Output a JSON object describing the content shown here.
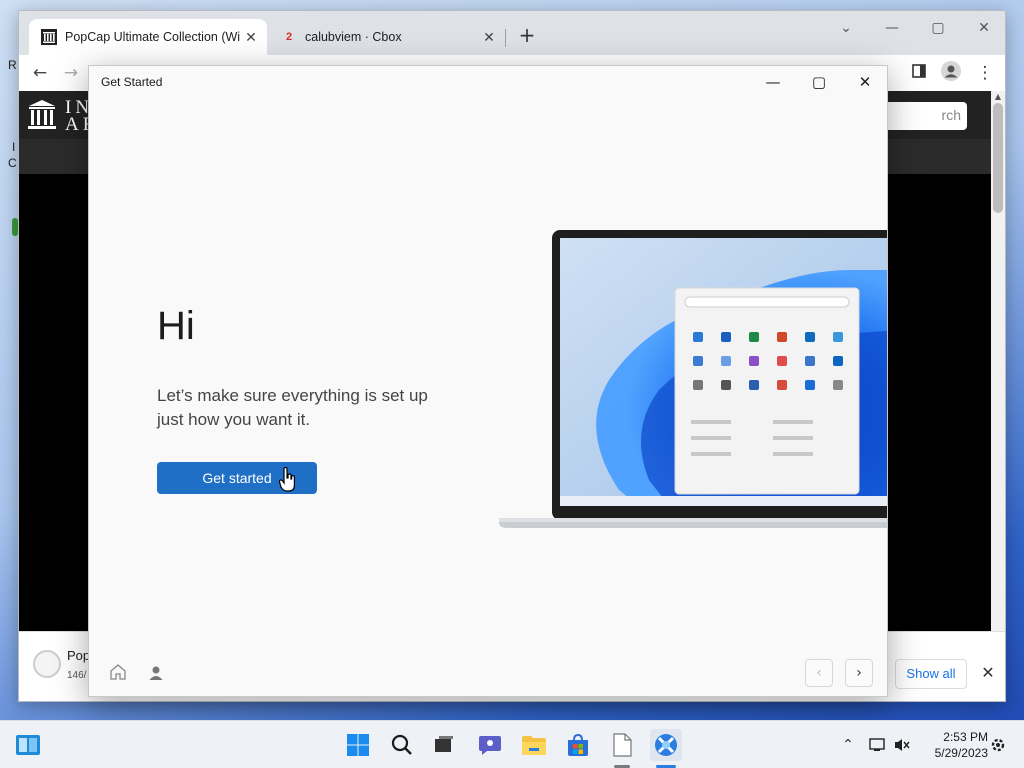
{
  "desktop": {
    "left_fragments": [
      "R",
      "I",
      "C"
    ]
  },
  "browser": {
    "tabs": [
      {
        "title": "PopCap Ultimate Collection (Wi",
        "active": true
      },
      {
        "title": "calubviem · Cbox",
        "badge": "2",
        "active": false
      }
    ],
    "page": {
      "logo_text_line1": "IN",
      "logo_text_line2": "AR",
      "search_placeholder": "rch"
    },
    "download": {
      "name": "Pop",
      "size": "146/"
    },
    "show_all_label": "Show all"
  },
  "dialog": {
    "title": "Get Started",
    "heading": "Hi",
    "subtext": "Let’s make sure everything is set up just how you want it.",
    "button_label": "Get started",
    "colors": {
      "accent": "#1f6fc7"
    }
  },
  "taskbar": {
    "time": "2:53 PM",
    "date": "5/29/2023"
  },
  "icons": {
    "tab1": "museum-icon",
    "dialog_home": "home-icon",
    "dialog_account": "person-icon"
  }
}
